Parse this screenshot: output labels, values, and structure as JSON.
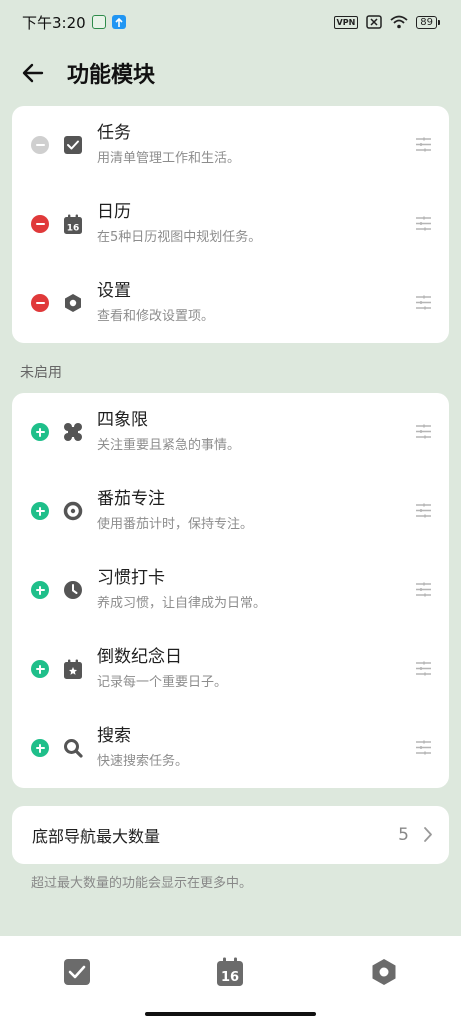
{
  "status_bar": {
    "time": "下午3:20",
    "vpn": "VPN",
    "battery": "89"
  },
  "header": {
    "title": "功能模块"
  },
  "enabled_modules": [
    {
      "name": "任务",
      "desc": "用清单管理工作和生活。",
      "icon": "checkbox-icon",
      "state": "locked"
    },
    {
      "name": "日历",
      "desc": "在5种日历视图中规划任务。",
      "icon": "calendar-icon",
      "state": "enabled"
    },
    {
      "name": "设置",
      "desc": "查看和修改设置项。",
      "icon": "hexagon-settings-icon",
      "state": "enabled"
    }
  ],
  "disabled_section_label": "未启用",
  "disabled_modules": [
    {
      "name": "四象限",
      "desc": "关注重要且紧急的事情。",
      "icon": "four-leaf-icon"
    },
    {
      "name": "番茄专注",
      "desc": "使用番茄计时，保持专注。",
      "icon": "pomodoro-ring-icon"
    },
    {
      "name": "习惯打卡",
      "desc": "养成习惯，让自律成为日常。",
      "icon": "clock-icon"
    },
    {
      "name": "倒数纪念日",
      "desc": "记录每一个重要日子。",
      "icon": "star-calendar-icon"
    },
    {
      "name": "搜索",
      "desc": "快速搜索任务。",
      "icon": "search-icon"
    }
  ],
  "bottom_nav_setting": {
    "label": "底部导航最大数量",
    "value": "5",
    "hint": "超过最大数量的功能会显示在更多中。"
  },
  "calendar_day": "16",
  "colors": {
    "background": "#dde8dd",
    "remove": "#e0393a",
    "add": "#1fbf8a",
    "icon": "#555555"
  }
}
